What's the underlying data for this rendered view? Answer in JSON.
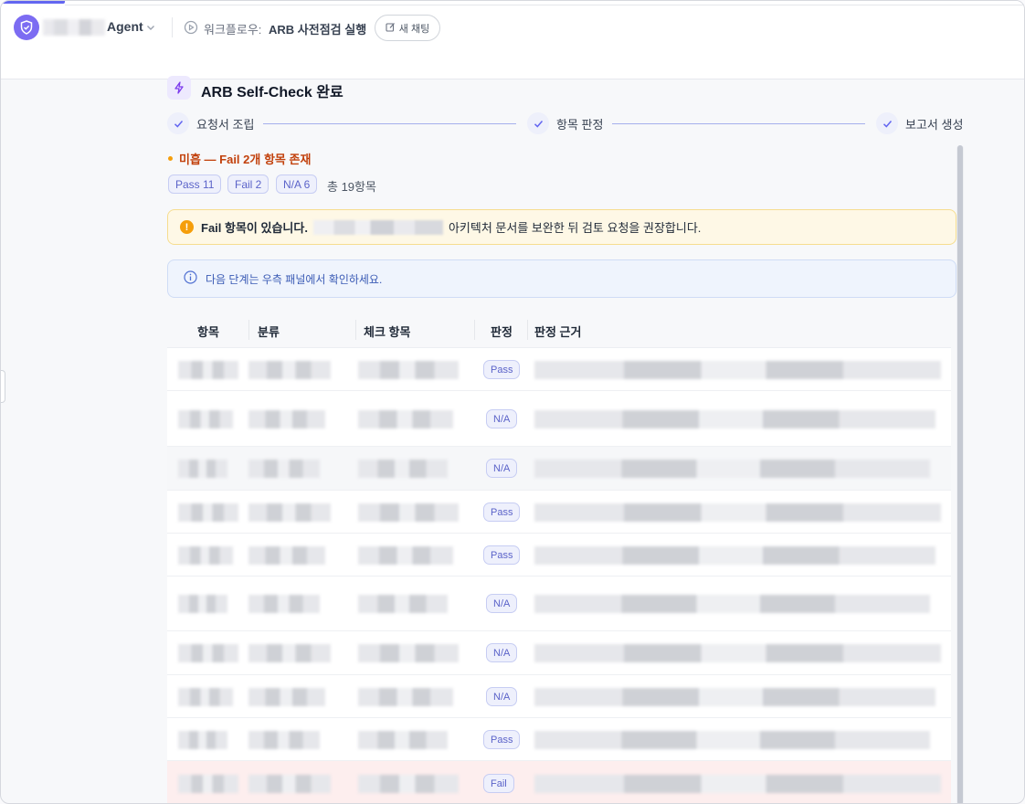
{
  "header": {
    "agent_name": "Agent",
    "workflow_prefix": "워크플로우:",
    "workflow_title": "ARB 사전점검 실행",
    "new_chat_label": "새 채팅"
  },
  "main": {
    "title": "ARB Self-Check 완료",
    "steps": [
      "요청서 조립",
      "항목 판정",
      "보고서 생성"
    ],
    "status": "미흡 — Fail 2개 항목 존재",
    "badges": [
      "Pass 11",
      "Fail 2",
      "N/A 6"
    ],
    "total": "총 19항목",
    "warning_strong": "Fail 항목이 있습니다.",
    "warning_text": "아키텍처 문서를 보완한 뒤 검토 요청을 권장합니다.",
    "info_text": "다음 단계는 우측 패널에서 확인하세요."
  },
  "table": {
    "headers": [
      "항목",
      "분류",
      "체크 항목",
      "판정",
      "판정 근거"
    ],
    "rows": [
      {
        "verdict": "Pass"
      },
      {
        "verdict": "N/A"
      },
      {
        "verdict": "N/A"
      },
      {
        "verdict": "Pass"
      },
      {
        "verdict": "Pass"
      },
      {
        "verdict": "N/A"
      },
      {
        "verdict": "N/A"
      },
      {
        "verdict": "N/A"
      },
      {
        "verdict": "Pass"
      },
      {
        "verdict": "Fail"
      }
    ]
  },
  "colors": {
    "accent": "#6366f1",
    "status_text": "#c2410c",
    "warning_bg": "#fef8e6",
    "info_bg": "#eff4fd",
    "fail_row_bg": "#fdeeee"
  }
}
